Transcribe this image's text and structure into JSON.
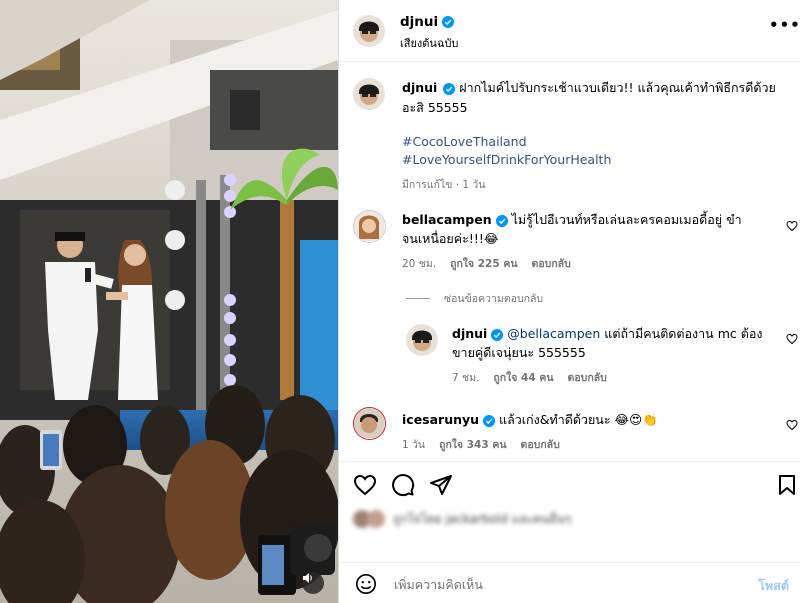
{
  "header": {
    "username": "djnui",
    "subtitle": "เสียงต้นฉบับ",
    "more_label": "•••"
  },
  "caption": {
    "username": "djnui",
    "text": "ฝากไมค์ไปรับกระเช้าแวบเดียว!! แล้วคุณเค้าทำพิธีกรดีด้วยอะสิ 55555",
    "hashtags": [
      "#CocoLoveThailand",
      "#LoveYourselfDrinkForYourHealth"
    ],
    "meta": "มีการแก้ไข · 1 วัน"
  },
  "comments": [
    {
      "username": "bellacampen",
      "text": "ไม่รู้ไปอีเวนท์หรือเล่นละครคอมเมอดี้อยู่ ขำจนเหนื่อยค่ะ!!!😂",
      "time": "20 ชม.",
      "likes": "ถูกใจ 225 คน",
      "reply_label": "ตอบกลับ"
    },
    {
      "username": "icesarunyu",
      "text": "แล้วเก่ง&ทำดีด้วยนะ 😂😍👏",
      "time": "1 วัน",
      "likes": "ถูกใจ 343 คน",
      "reply_label": "ตอบกลับ"
    }
  ],
  "hide_replies_label": "ซ่อนข้อความตอบกลับ",
  "reply": {
    "username": "djnui",
    "mention": "@bellacampen",
    "text": "แต่ถ้ามีคนติดต่องาน mc ต้องขายคู่ดีเจนุ่ยนะ 555555",
    "time": "7 ชม.",
    "likes": "ถูกใจ 44 คน",
    "reply_label": "ตอบกลับ"
  },
  "likes_row_text": "ถูกใจโดย jackarbold และคนอื่นๆ",
  "add_comment": {
    "placeholder": "เพิ่มความคิดเห็น",
    "post_label": "โพสต์"
  },
  "icons": {
    "verified": "verified-badge-icon",
    "like": "heart-icon",
    "comment": "comment-bubble-icon",
    "share": "paper-plane-icon",
    "save": "bookmark-icon",
    "emoji": "smiley-face-icon",
    "mute": "speaker-icon"
  },
  "colors": {
    "verified": "#0095f6",
    "hashtag": "#385185",
    "meta_grey": "#737373",
    "post_disabled": "#a0c8f5"
  }
}
